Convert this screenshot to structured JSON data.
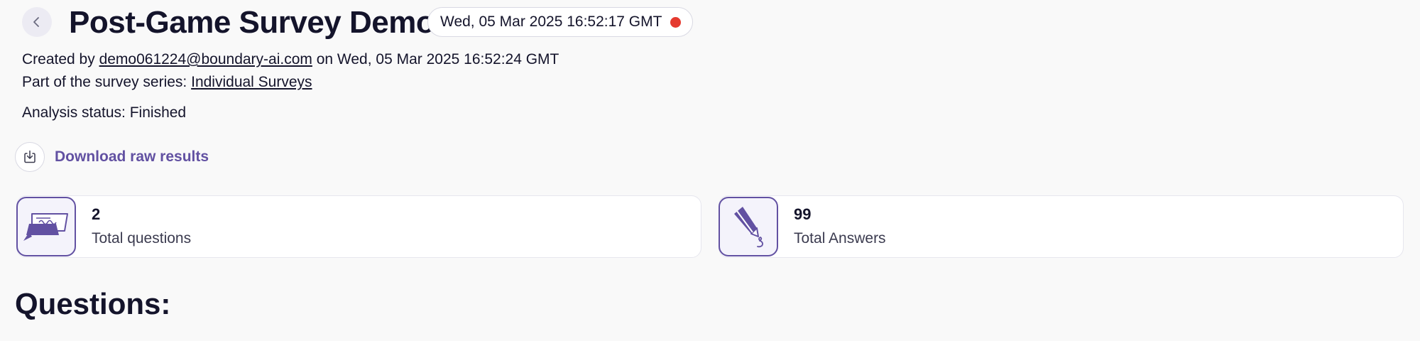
{
  "header": {
    "title": "Post-Game Survey Demo",
    "date_badge": "Wed, 05 Mar 2025 16:52:17 GMT",
    "status_color": "#e53a2f",
    "back_icon": "chevron-left-icon"
  },
  "meta": {
    "created_prefix": "Created by ",
    "creator_email": "demo061224@boundary-ai.com",
    "created_suffix": " on Wed, 05 Mar 2025 16:52:24 GMT",
    "series_prefix": "Part of the survey series: ",
    "series_name": "Individual Surveys",
    "analysis_status": "Analysis status: Finished"
  },
  "download": {
    "label": "Download raw results",
    "icon": "download-icon"
  },
  "stats": [
    {
      "value": "2",
      "label": "Total questions",
      "icon": "chat-bubble-icon"
    },
    {
      "value": "99",
      "label": "Total Answers",
      "icon": "pen-signature-icon"
    }
  ],
  "sections": {
    "questions_heading": "Questions:"
  },
  "colors": {
    "accent": "#6251a2",
    "background": "#f9f9f9",
    "text": "#14142b"
  }
}
